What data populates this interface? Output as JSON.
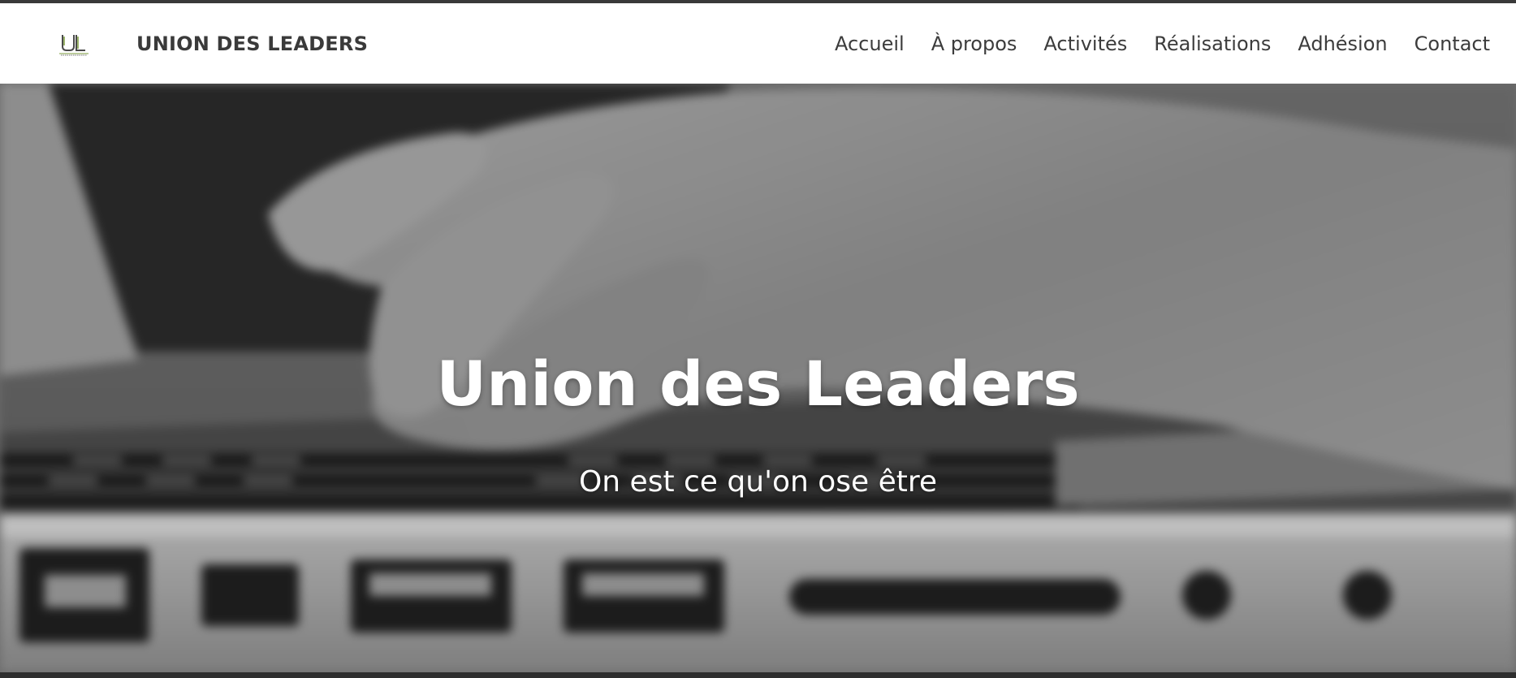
{
  "header": {
    "brand": "UNION DES LEADERS",
    "logo_icon": "ul-logo-icon",
    "nav": [
      {
        "label": "Accueil"
      },
      {
        "label": "À propos"
      },
      {
        "label": "Activités"
      },
      {
        "label": "Réalisations"
      },
      {
        "label": "Adhésion"
      },
      {
        "label": "Contact"
      }
    ]
  },
  "hero": {
    "title": "Union des Leaders",
    "subtitle": "On est ce qu'on ose être",
    "background": "laptop-typing-hands-grayscale"
  },
  "colors": {
    "nav_bg": "#ffffff",
    "nav_text": "#3c3c3c",
    "hero_text": "#ffffff",
    "logo_accent": "#7a9a3a"
  }
}
